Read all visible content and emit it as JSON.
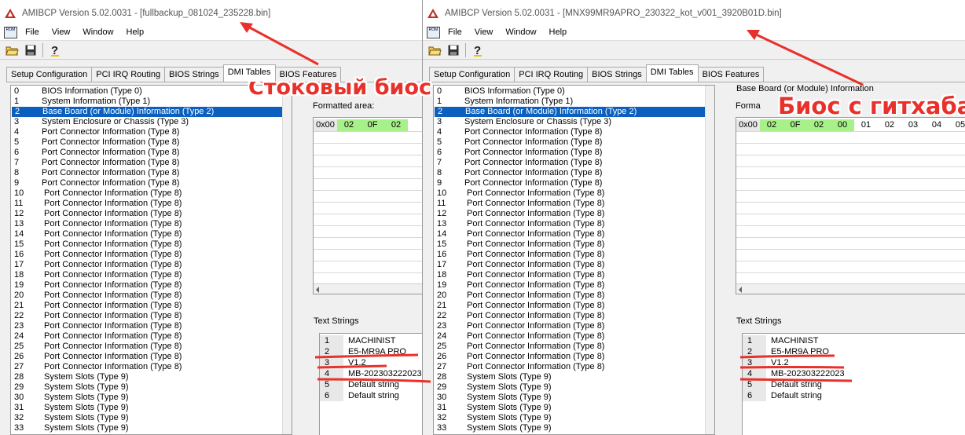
{
  "left": {
    "title": "AMIBCP Version 5.02.0031 - [fullbackup_081024_235228.bin]",
    "overlay_label": "Стоковый биос",
    "hex_cells": [
      "0x00",
      "02",
      "0F",
      "02"
    ],
    "text_strings": [
      [
        "1",
        "MACHINIST"
      ],
      [
        "2",
        "E5-MR9A PRO"
      ],
      [
        "3",
        "V1.2"
      ],
      [
        "4",
        "MB-202303222023"
      ],
      [
        "5",
        "Default string"
      ],
      [
        "6",
        "Default string"
      ]
    ]
  },
  "right": {
    "title": "AMIBCP Version 5.02.0031 - [MNX99MR9APRO_230322_kot_v001_3920B01D.bin]",
    "overlay_label": "Биос с гитхаба",
    "group_title": "Base Board (or Module) Information",
    "formatted_label": "Forma",
    "hex_cells": [
      "0x00",
      "02",
      "0F",
      "02",
      "00",
      "01",
      "02",
      "03",
      "04",
      "05"
    ],
    "text_strings": [
      [
        "1",
        "MACHINIST"
      ],
      [
        "2",
        "E5-MR9A PRO"
      ],
      [
        "3",
        "V1.2"
      ],
      [
        "4",
        "MB-202303222023"
      ],
      [
        "5",
        "Default string"
      ],
      [
        "6",
        "Default string"
      ]
    ]
  },
  "menu": [
    "File",
    "View",
    "Window",
    "Help"
  ],
  "rom_icon_text": "ROM",
  "tabs": [
    "Setup Configuration",
    "PCI IRQ Routing",
    "BIOS Strings",
    "DMI Tables",
    "BIOS Features"
  ],
  "left_group_title_fragment": "du",
  "formatted_area_label": "Formatted area:",
  "text_strings_label": "Text Strings",
  "dmi_items": [
    [
      "0",
      "BIOS Information  (Type 0)"
    ],
    [
      "1",
      "System Information  (Type 1)"
    ],
    [
      "2",
      "Base Board (or Module) Information  (Type 2)"
    ],
    [
      "3",
      "System Enclosure or Chassis  (Type 3)"
    ],
    [
      "4",
      "Port Connector Information  (Type 8)"
    ],
    [
      "5",
      "Port Connector Information  (Type 8)"
    ],
    [
      "6",
      "Port Connector Information  (Type 8)"
    ],
    [
      "7",
      "Port Connector Information  (Type 8)"
    ],
    [
      "8",
      "Port Connector Information  (Type 8)"
    ],
    [
      "9",
      "Port Connector Information  (Type 8)"
    ],
    [
      "10",
      "Port Connector Information  (Type 8)"
    ],
    [
      "11",
      "Port Connector Information  (Type 8)"
    ],
    [
      "12",
      "Port Connector Information  (Type 8)"
    ],
    [
      "13",
      "Port Connector Information  (Type 8)"
    ],
    [
      "14",
      "Port Connector Information  (Type 8)"
    ],
    [
      "15",
      "Port Connector Information  (Type 8)"
    ],
    [
      "16",
      "Port Connector Information  (Type 8)"
    ],
    [
      "17",
      "Port Connector Information  (Type 8)"
    ],
    [
      "18",
      "Port Connector Information  (Type 8)"
    ],
    [
      "19",
      "Port Connector Information  (Type 8)"
    ],
    [
      "20",
      "Port Connector Information  (Type 8)"
    ],
    [
      "21",
      "Port Connector Information  (Type 8)"
    ],
    [
      "22",
      "Port Connector Information  (Type 8)"
    ],
    [
      "23",
      "Port Connector Information  (Type 8)"
    ],
    [
      "24",
      "Port Connector Information  (Type 8)"
    ],
    [
      "25",
      "Port Connector Information  (Type 8)"
    ],
    [
      "26",
      "Port Connector Information  (Type 8)"
    ],
    [
      "27",
      "Port Connector Information  (Type 8)"
    ],
    [
      "28",
      "System Slots  (Type 9)"
    ],
    [
      "29",
      "System Slots  (Type 9)"
    ],
    [
      "30",
      "System Slots  (Type 9)"
    ],
    [
      "31",
      "System Slots  (Type 9)"
    ],
    [
      "32",
      "System Slots  (Type 9)"
    ],
    [
      "33",
      "System Slots  (Type 9)"
    ]
  ],
  "selected_index": 2,
  "colors": {
    "selection": "#0a5fbf",
    "hex_highlight": "#a8f08a",
    "annotation": "#e8312a"
  }
}
